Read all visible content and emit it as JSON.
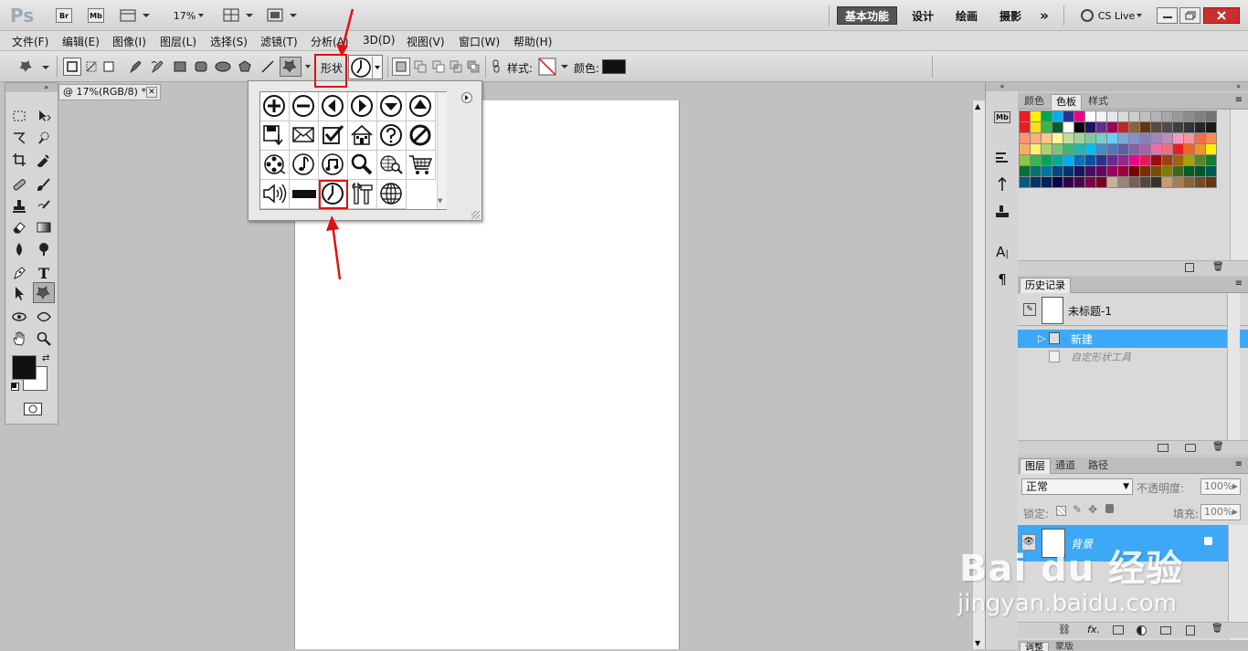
{
  "app": {
    "logo": "Ps",
    "zoom": "17%",
    "bridge_label": "Br",
    "minibridge_label": "Mb"
  },
  "workspaces": [
    "基本功能",
    "设计",
    "绘画",
    "摄影"
  ],
  "cs_live": "CS Live",
  "menus": [
    "文件(F)",
    "编辑(E)",
    "图像(I)",
    "图层(L)",
    "选择(S)",
    "滤镜(T)",
    "分析(A)",
    "3D(D)",
    "视图(V)",
    "窗口(W)",
    "帮助(H)"
  ],
  "options_bar": {
    "shape_label": "形状",
    "style_label": "样式:",
    "color_label": "颜色:",
    "color_value": "#111111"
  },
  "document": {
    "tab_title": "@ 17%(RGB/8) *"
  },
  "shape_picker": {
    "shapes": [
      "plus-circle",
      "minus-circle",
      "arrow-left-circle",
      "arrow-right-circle",
      "arrow-down-circle",
      "arrow-up-circle",
      "floppy-save",
      "envelope",
      "checkbox",
      "house",
      "question-circle",
      "no-sign",
      "film-reel",
      "music-note-circle",
      "music-notes-circle",
      "magnifier",
      "web-search",
      "shopping-cart",
      "speaker",
      "rectangle-bar",
      "clock",
      "tools",
      "globe"
    ],
    "selected": "clock"
  },
  "panels": {
    "color_tabs": [
      "颜色",
      "色板",
      "样式"
    ],
    "swatch_colors": [
      "#ed1c24",
      "#fff200",
      "#00a651",
      "#00aeef",
      "#2e3192",
      "#ec008c",
      "#ffffff",
      "#f2f2f2",
      "#e6e6e6",
      "#d9d9d9",
      "#cccccc",
      "#bfbfbf",
      "#b3b3b3",
      "#a6a6a6",
      "#999999",
      "#8c8c8c",
      "#808080",
      "#737373",
      "#ed1c24",
      "#ffde17",
      "#39b54a",
      "#005f2f",
      "#fff",
      "#000",
      "#1b1464",
      "#662d91",
      "#9e005d",
      "#c1272d",
      "#8c6239",
      "#603813",
      "#594a42",
      "#4d4d4d",
      "#404040",
      "#333333",
      "#262626",
      "#1a1a1a",
      "#f7977a",
      "#f9ad81",
      "#fdc68a",
      "#fff79a",
      "#c4df9b",
      "#a3d39c",
      "#82ca9d",
      "#7accc8",
      "#6dcff6",
      "#7da7d9",
      "#8393ca",
      "#8781bd",
      "#a187be",
      "#bd8cbf",
      "#f49ac1",
      "#f5989d",
      "#f26c4f",
      "#f68e55",
      "#fbaf5c",
      "#fff467",
      "#acd372",
      "#7cc576",
      "#3bb878",
      "#1abbb4",
      "#00bff3",
      "#438ccb",
      "#5574b9",
      "#605ca8",
      "#855fa8",
      "#a763a8",
      "#f06eaa",
      "#f26d7d",
      "#ed1c24",
      "#f26522",
      "#f7941d",
      "#fff200",
      "#8dc63f",
      "#39b54a",
      "#00a651",
      "#00a99d",
      "#00aeef",
      "#0072bc",
      "#0054a6",
      "#2e3192",
      "#662d91",
      "#92278f",
      "#ec008c",
      "#ed145b",
      "#9e0b0f",
      "#a0410d",
      "#a36209",
      "#aba000",
      "#598527",
      "#197b30",
      "#007236",
      "#00746b",
      "#0076a3",
      "#004a80",
      "#003471",
      "#1b1464",
      "#440e62",
      "#630460",
      "#9e005d",
      "#9e0039",
      "#790000",
      "#7b2e00",
      "#7d4900",
      "#827b00",
      "#406618",
      "#005e20",
      "#005826",
      "#005952",
      "#005b7f",
      "#003663",
      "#002157",
      "#0d004c",
      "#32004b",
      "#4b0049",
      "#7b0046",
      "#7a0026",
      "#c7b299",
      "#998675",
      "#736357",
      "#534741",
      "#37302d",
      "#c69c6d",
      "#a67c52",
      "#8c6239",
      "#754c24",
      "#603913"
    ],
    "history_tab": "历史记录",
    "history_snapshot": "未标题-1",
    "history_items": [
      "新建",
      "自定形状工具"
    ],
    "layers_tabs": [
      "图层",
      "通道",
      "路径"
    ],
    "blend_mode": "正常",
    "opacity_label": "不透明度:",
    "opacity_value": "100%",
    "lock_label": "锁定:",
    "fill_label": "填充:",
    "fill_value": "100%",
    "layer_name": "背景",
    "bottom_tabs": [
      "调整",
      "蒙版"
    ]
  },
  "watermark": {
    "brand": "Bai du 经验",
    "url": "jingyan.baidu.com"
  }
}
